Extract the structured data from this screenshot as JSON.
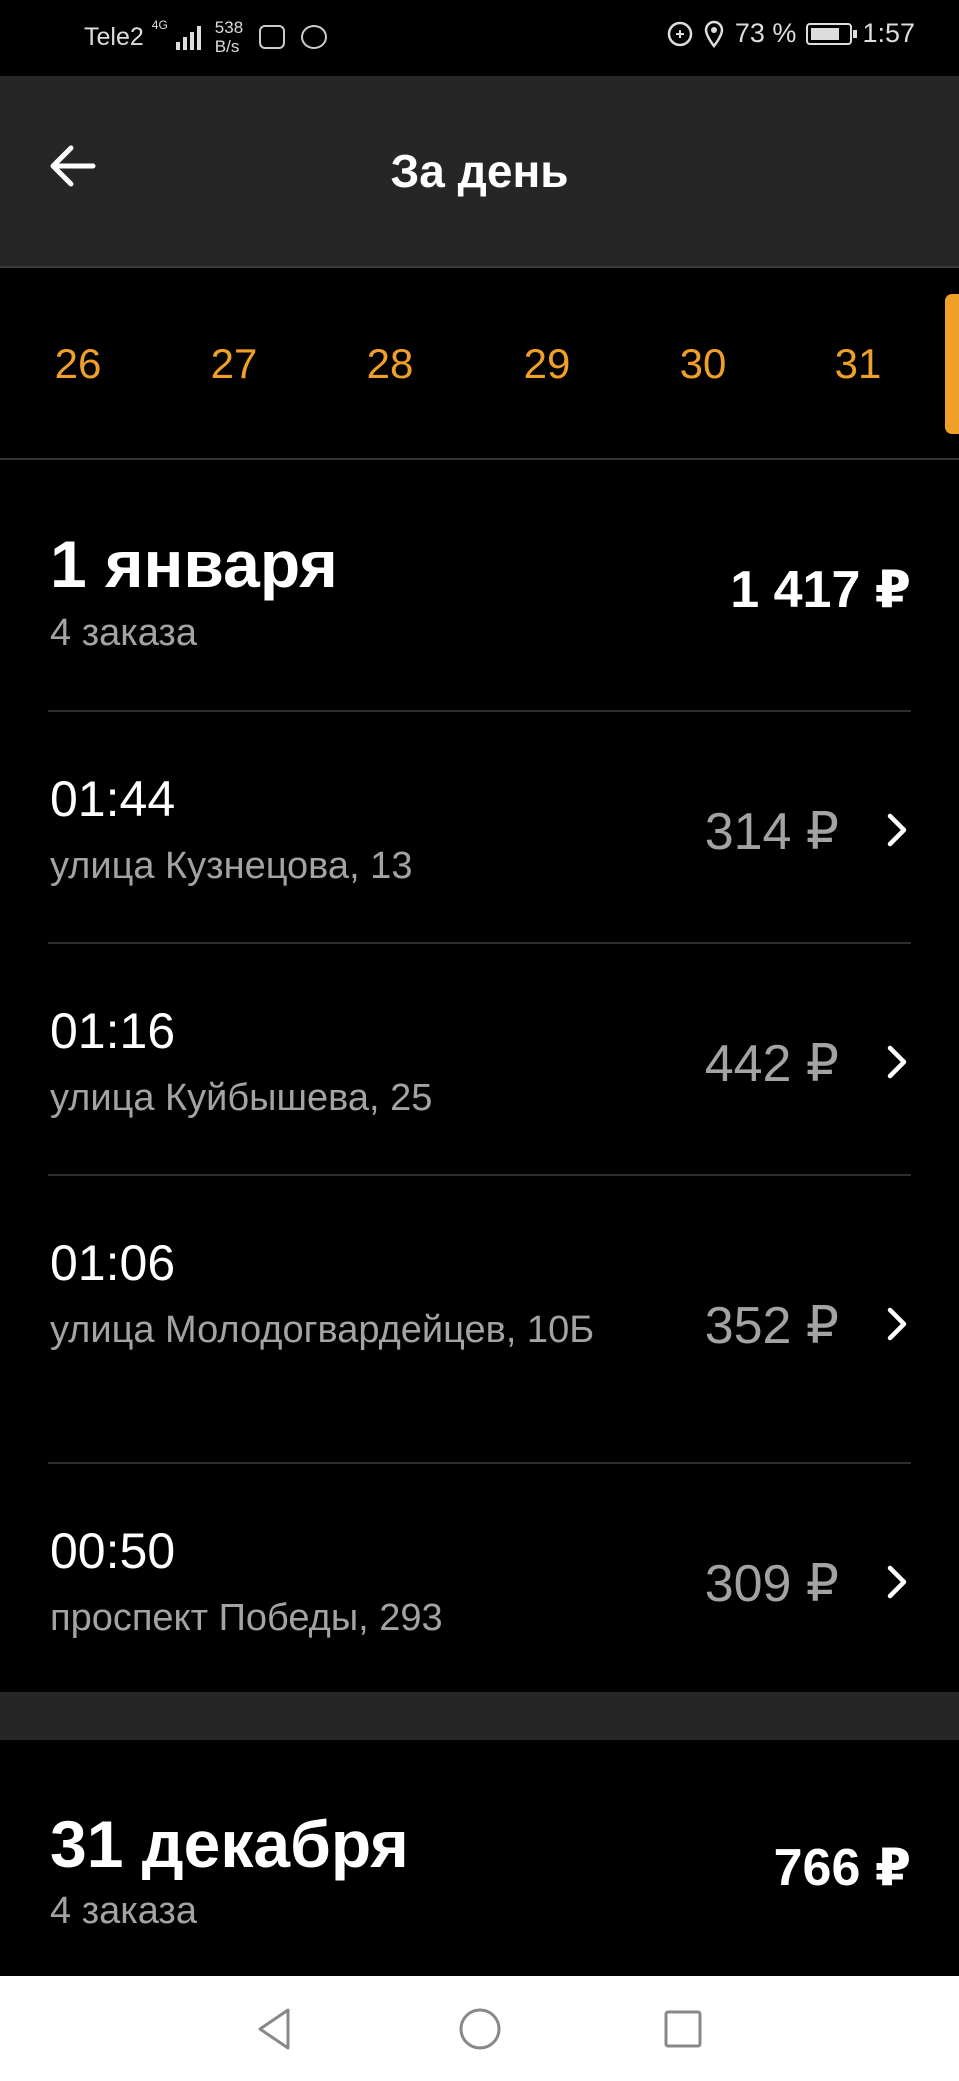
{
  "status_bar": {
    "carrier": "Tele2",
    "network": "4G",
    "speed_value": "538",
    "speed_unit": "B/s",
    "battery": "73 %",
    "time": "1:57"
  },
  "header": {
    "title": "За день"
  },
  "day_selector": {
    "days": [
      "26",
      "27",
      "28",
      "29",
      "30",
      "31"
    ]
  },
  "groups": [
    {
      "date": "1 января",
      "count": "4 заказа",
      "total": "1 417 ₽",
      "orders": [
        {
          "time": "01:44",
          "address": "улица Кузнецова, 13",
          "price": "314 ₽"
        },
        {
          "time": "01:16",
          "address": "улица Куйбышева, 25",
          "price": "442 ₽"
        },
        {
          "time": "01:06",
          "address": "улица Молодогвардейцев, 10Б",
          "price": "352 ₽"
        },
        {
          "time": "00:50",
          "address": "проспект Победы, 293",
          "price": "309 ₽"
        }
      ]
    },
    {
      "date": "31 декабря",
      "count": "4 заказа",
      "total": "766 ₽"
    }
  ],
  "colors": {
    "accent": "#f0a028",
    "background": "#000000",
    "appbar": "#262626",
    "secondary_text": "#a3a3a3"
  }
}
